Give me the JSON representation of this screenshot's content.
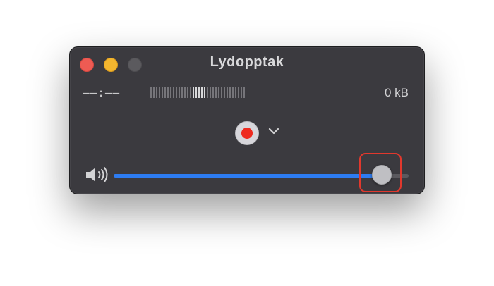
{
  "window": {
    "title": "Lydopptak"
  },
  "recording": {
    "time": "––:––",
    "size": "0 kB"
  },
  "meter": {
    "bars": 34,
    "highlighted_from": 15,
    "highlighted_to": 19
  },
  "controls": {
    "record_icon": "record-icon",
    "options_icon": "chevron-down-icon"
  },
  "volume": {
    "icon": "speaker-icon",
    "level": 0.91
  },
  "colors": {
    "close": "#ee5b53",
    "minimize": "#f3b62f",
    "record_dot": "#ee2a1f",
    "slider_fill": "#2d7cf2",
    "highlight_box": "#e1382d"
  }
}
